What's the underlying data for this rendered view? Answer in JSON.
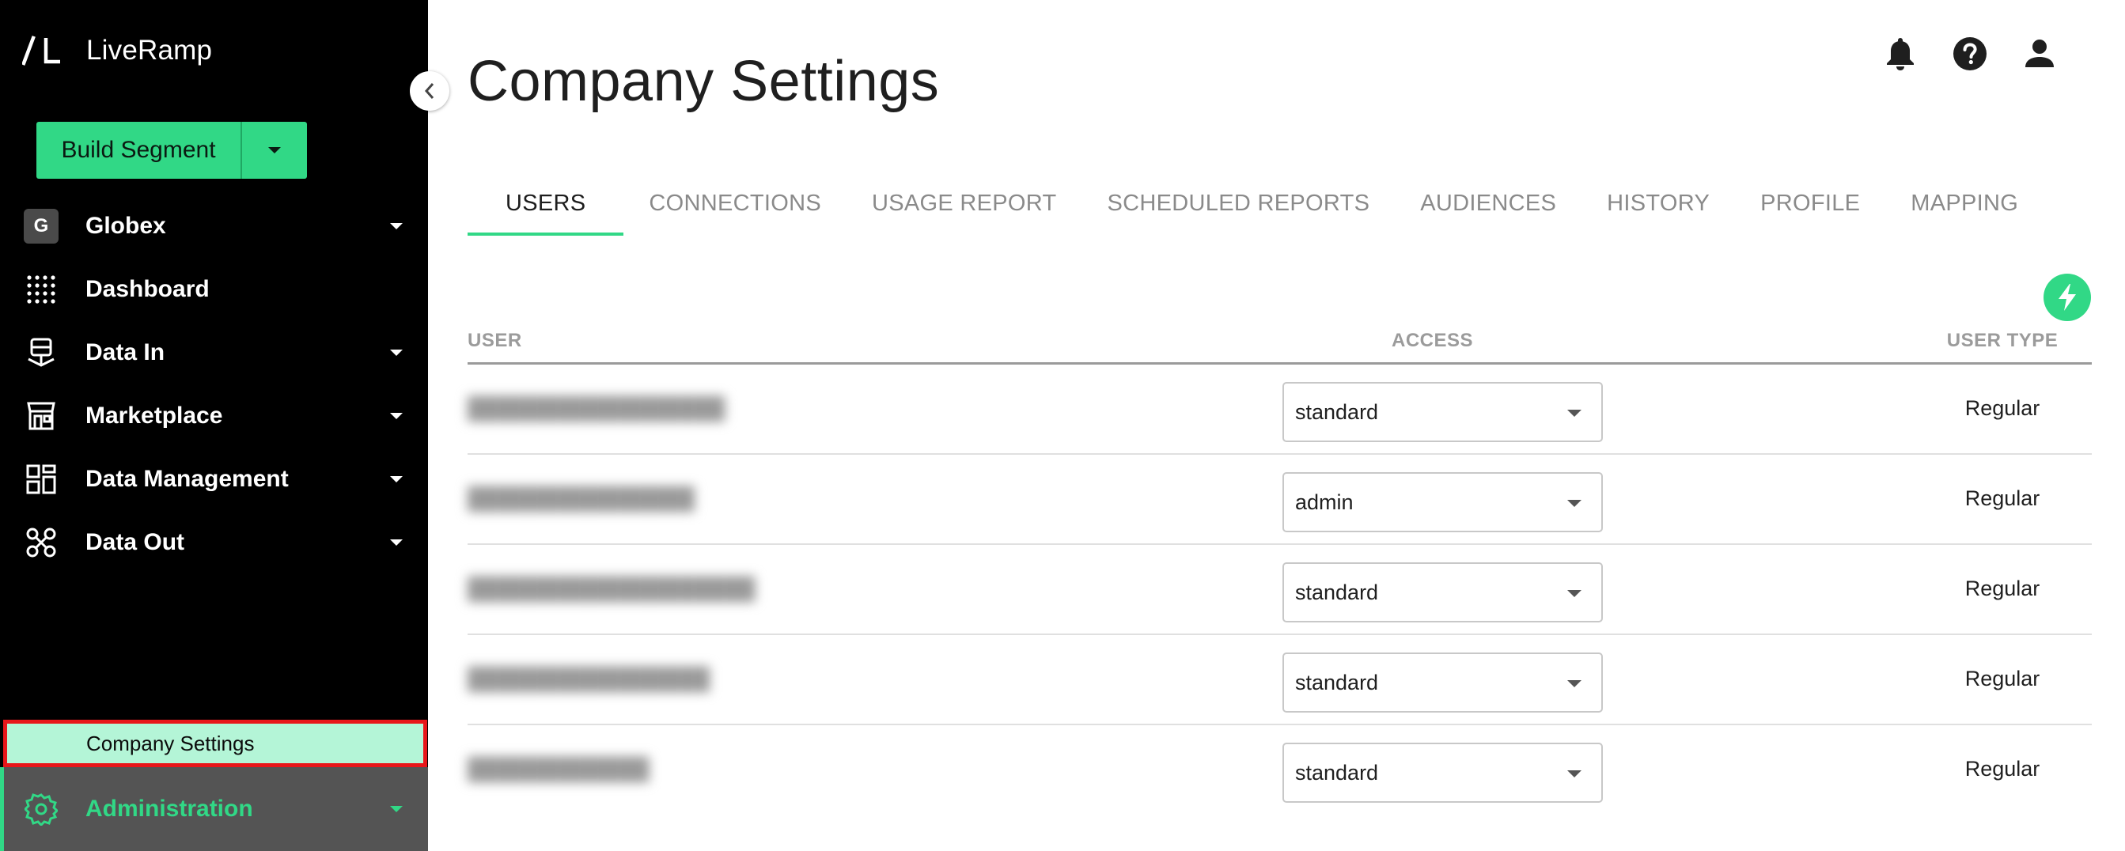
{
  "brand": {
    "name": "LiveRamp"
  },
  "sidebar": {
    "build_segment_label": "Build Segment",
    "account": {
      "initial": "G",
      "name": "Globex"
    },
    "items": [
      {
        "label": "Dashboard",
        "icon": "dashboard-icon",
        "has_caret": false
      },
      {
        "label": "Data In",
        "icon": "data-in-icon",
        "has_caret": true
      },
      {
        "label": "Marketplace",
        "icon": "marketplace-icon",
        "has_caret": true
      },
      {
        "label": "Data Management",
        "icon": "data-management-icon",
        "has_caret": true
      },
      {
        "label": "Data Out",
        "icon": "data-out-icon",
        "has_caret": true
      }
    ],
    "company_settings_label": "Company Settings",
    "administration_label": "Administration"
  },
  "page": {
    "title": "Company Settings"
  },
  "header_icons": [
    "bell-icon",
    "help-icon",
    "account-icon"
  ],
  "tabs": [
    {
      "label": "USERS",
      "active": true
    },
    {
      "label": "CONNECTIONS",
      "active": false
    },
    {
      "label": "USAGE REPORT",
      "active": false
    },
    {
      "label": "SCHEDULED REPORTS",
      "active": false
    },
    {
      "label": "AUDIENCES",
      "active": false
    },
    {
      "label": "HISTORY",
      "active": false
    },
    {
      "label": "PROFILE",
      "active": false
    },
    {
      "label": "MAPPING",
      "active": false
    }
  ],
  "table": {
    "columns": {
      "user": "USER",
      "access": "ACCESS",
      "user_type": "USER TYPE"
    },
    "rows": [
      {
        "access": "standard",
        "user_type": "Regular"
      },
      {
        "access": "admin",
        "user_type": "Regular"
      },
      {
        "access": "standard",
        "user_type": "Regular"
      },
      {
        "access": "standard",
        "user_type": "Regular"
      },
      {
        "access": "standard",
        "user_type": "Regular"
      }
    ]
  },
  "colors": {
    "accent": "#31d886",
    "sidebar_bg": "#000000",
    "highlight_bg": "#b4f5d7",
    "highlight_border": "#e8161a",
    "admin_bg": "#545454"
  }
}
